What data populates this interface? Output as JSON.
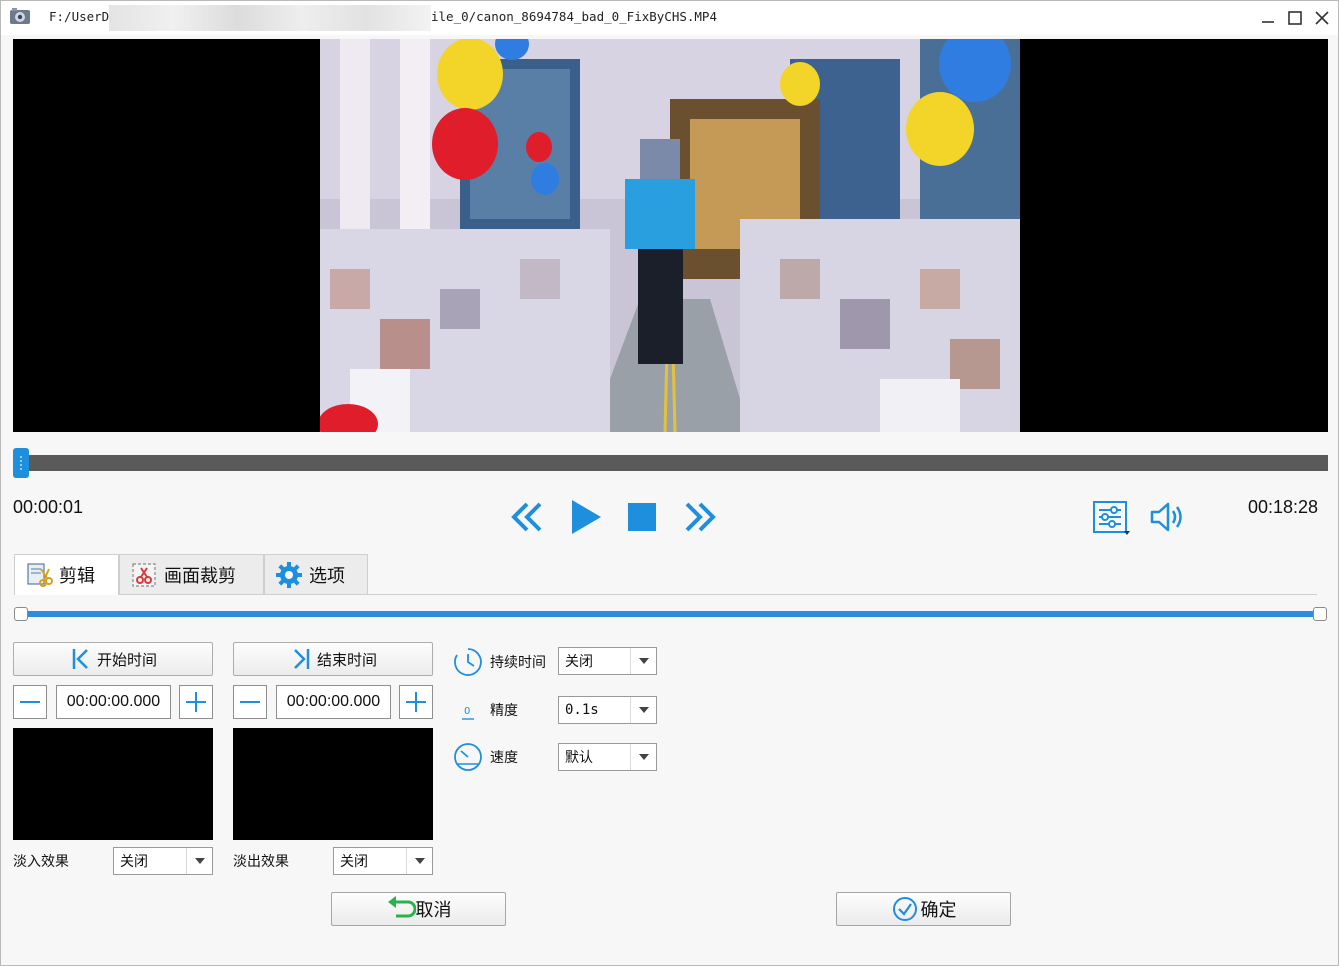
{
  "window": {
    "title_left": "F:/UserD",
    "title_right": "ile_0/canon_8694784_bad_0_FixByCHS.MP4"
  },
  "player": {
    "current_time": "00:00:01",
    "total_time": "00:18:28",
    "seek_progress": 0.0
  },
  "tabs": [
    {
      "label": "剪辑",
      "icon": "cut-edit-icon",
      "active": true
    },
    {
      "label": "画面裁剪",
      "icon": "crop-icon",
      "active": false
    },
    {
      "label": "选项",
      "icon": "gear-icon",
      "active": false
    }
  ],
  "clip": {
    "start_button": "开始时间",
    "end_button": "结束时间",
    "start_value": "00:00:00.000",
    "end_value": "00:00:00.000",
    "fade_in_label": "淡入效果",
    "fade_out_label": "淡出效果",
    "fade_in_value": "关闭",
    "fade_out_value": "关闭",
    "range_start": 0.0,
    "range_end": 1.0
  },
  "options": {
    "duration_label": "持续时间",
    "duration_value": "关闭",
    "precision_label": "精度",
    "precision_value": "0.1s",
    "speed_label": "速度",
    "speed_value": "默认"
  },
  "actions": {
    "cancel": "取消",
    "confirm": "确定"
  },
  "colors": {
    "accent": "#1e8fdc",
    "seek_track": "#5a5a5a"
  }
}
